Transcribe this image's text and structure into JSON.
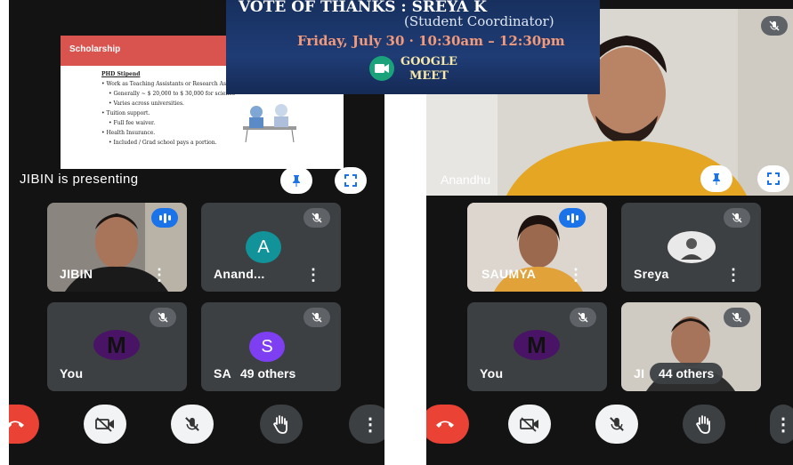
{
  "banner": {
    "line1": "VOTE OF THANKS  :   SREYA K",
    "line2": "(Student Coordinator)",
    "line3": "Friday, July 30 · 10:30am – 12:30pm",
    "meet_line1": "GOOGLE",
    "meet_line2": "MEET"
  },
  "left": {
    "slide": {
      "title": "Scholarship",
      "lines": [
        "PHD Stipend",
        "• Work as Teaching Assistants or Research Assis",
        "• Generally ~ $ 20,000 to $ 30,000 for science",
        "• Varies across universities.",
        "• Tuition support.",
        "• Full fee waiver.",
        "• Health Insurance.",
        "• Included / Grad school pays a portion."
      ]
    },
    "presenting_label": "JIBIN is presenting",
    "tiles": [
      {
        "name": "JIBIN"
      },
      {
        "name": "Anand...",
        "initial": "A",
        "color": "#12939a"
      },
      {
        "name": "You",
        "initial": "M",
        "color": "#4a1466"
      },
      {
        "name": "SA",
        "initial": "S",
        "color": "#7e3ff2"
      }
    ],
    "others": "49 others"
  },
  "right": {
    "main_name": "Anandhu",
    "tiles": [
      {
        "name": "SAUMYA"
      },
      {
        "name": "Sreya"
      },
      {
        "name": "You",
        "initial": "M",
        "color": "#4a1466"
      },
      {
        "name": "JI"
      }
    ],
    "others": "44 others"
  },
  "icons": {
    "hangup": "phone-hangup-icon",
    "camera_off": "video-off-icon",
    "mic_off": "mic-off-icon",
    "raise_hand": "hand-icon",
    "more": "more-vert-icon",
    "pin": "pin-icon",
    "fullscreen": "fullscreen-icon"
  },
  "colors": {
    "accent_blue": "#1a73e8",
    "hangup_red": "#ea4335",
    "tile_bg": "#3c4043"
  }
}
